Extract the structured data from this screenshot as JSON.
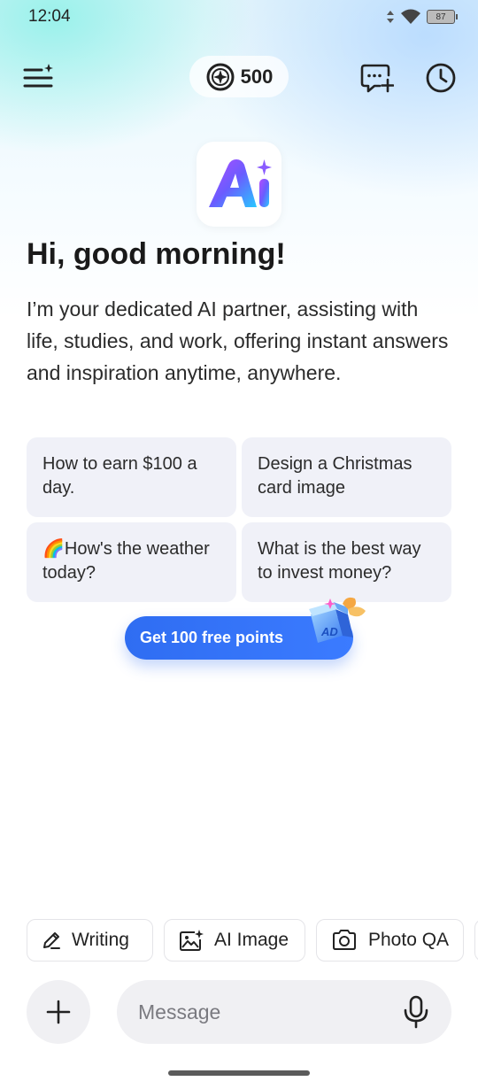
{
  "status_bar": {
    "time": "12:04",
    "battery": "87"
  },
  "header": {
    "points": "500"
  },
  "welcome": {
    "greeting": "Hi, good morning!",
    "intro": "I’m your dedicated AI partner, assisting with life, studies, and work, offering instant answers and inspiration anytime, anywhere."
  },
  "suggestions": [
    {
      "label": "How to earn $100 a day."
    },
    {
      "label": "Design a Christmas card image"
    },
    {
      "emoji": "🌈",
      "label": "How's the weather today?"
    },
    {
      "label": "What is the best way to invest money?"
    }
  ],
  "promo": {
    "label": "Get 100 free points",
    "badge": "AD"
  },
  "tools": [
    {
      "label": "Writing",
      "icon": "pencil-icon"
    },
    {
      "label": "AI Image",
      "icon": "image-sparkle-icon"
    },
    {
      "label": "Photo QA",
      "icon": "camera-icon"
    }
  ],
  "composer": {
    "placeholder": "Message"
  },
  "colors": {
    "accent": "#2f6df2",
    "chip_bg": "#f0f1f8",
    "input_bg": "#f0f0f3"
  }
}
